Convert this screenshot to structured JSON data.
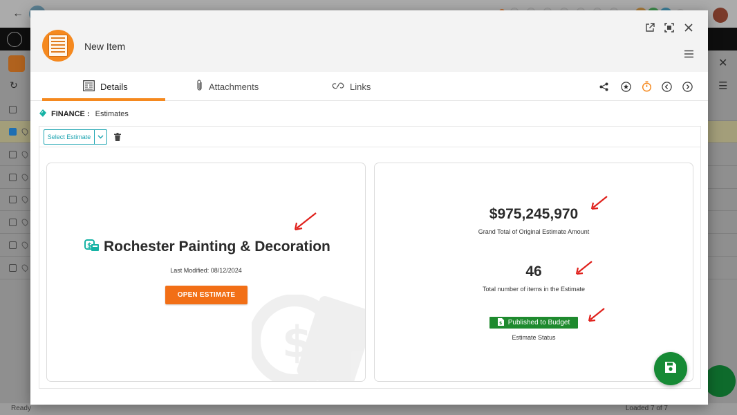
{
  "modal": {
    "title": "New Item",
    "tabs": [
      {
        "label": "Details",
        "icon": "details-icon",
        "active": true
      },
      {
        "label": "Attachments",
        "icon": "paperclip-icon",
        "active": false
      },
      {
        "label": "Links",
        "icon": "link-icon",
        "active": false
      }
    ],
    "breadcrumb": {
      "module": "FINANCE :",
      "page": "Estimates"
    },
    "select_estimate": {
      "value": "Select Estimate"
    },
    "estimate": {
      "name": "Rochester Painting & Decoration",
      "last_modified": "Last Modified: 08/12/2024",
      "open_button": "OPEN ESTIMATE"
    },
    "summary": {
      "grand_total": "$975,245,970",
      "grand_total_label": "Grand Total of Original Estimate Amount",
      "item_count": "46",
      "item_count_label": "Total number of items in the Estimate",
      "status": "Published to Budget",
      "status_label": "Estimate Status"
    }
  },
  "background": {
    "status_left": "Ready",
    "status_right": "Loaded 7 of 7"
  },
  "colors": {
    "accent": "#f5891f",
    "teal": "#1aa3b0",
    "status_green": "#1e8a2e",
    "save_fab": "#168a35",
    "annotation_arrow": "#e0201b"
  }
}
